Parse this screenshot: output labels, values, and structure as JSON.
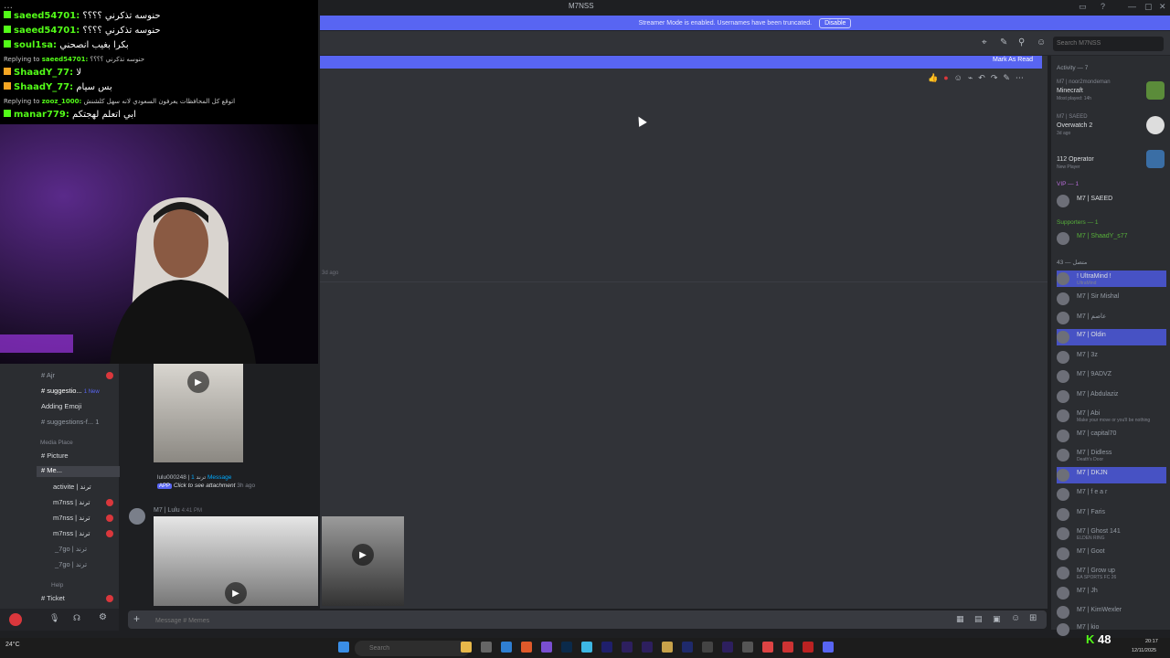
{
  "window": {
    "title": "M7NSS"
  },
  "banner": {
    "text": "Streamer Mode is enabled. Usernames have been truncated.",
    "disable_label": "Disable"
  },
  "header": {
    "search_placeholder": "Search M7NSS"
  },
  "unread": {
    "mark_as_read": "Mark As Read"
  },
  "main": {
    "ago_label": "3d ago"
  },
  "chat": [
    {
      "user": "saeed54701:",
      "text": "حنوسه تذكرني ؟؟؟؟"
    },
    {
      "user": "saeed54701:",
      "text": "حنوسه تذكرني ؟؟؟؟"
    },
    {
      "user": "soul1sa:",
      "text": "بكرا بغيب انصحني"
    },
    {
      "reply_prefix": "Replying to",
      "reply_user": "saeed54701:",
      "reply_text": "حنوسه تذكرني ؟؟؟؟"
    },
    {
      "user": "ShaadY_77:",
      "text": "لا"
    },
    {
      "user": "ShaadY_77:",
      "text": "بس سيام"
    },
    {
      "reply_prefix": "Replying to",
      "reply_user": "zooz_1000:",
      "reply_text": "اتوقع كل المحافظات يعرفون السعودي لانه سهل كلشنش"
    },
    {
      "user": "manar779:",
      "text": "ابي اتعلم لهجتكم"
    }
  ],
  "sidebar": {
    "channels": [
      {
        "name": "Ajr",
        "badge": "1"
      },
      {
        "name": "suggestio...",
        "badge": "1 New"
      },
      {
        "name": "Adding Emoji",
        "badge": ""
      },
      {
        "name": "suggestions-f...",
        "badge": "1"
      }
    ],
    "category_media": "Media Place",
    "media_channels": [
      {
        "name": "Picture"
      },
      {
        "name": "Me..."
      },
      {
        "name": "activite | ترند"
      },
      {
        "name": "m7nss | ترند"
      },
      {
        "name": "m7nss | ترند"
      },
      {
        "name": "m7nss | ترند"
      },
      {
        "name": "_7go | ترند"
      },
      {
        "name": "_7go | ترند"
      }
    ],
    "category_help": "Help",
    "help_channels": [
      {
        "name": "Ticket"
      }
    ]
  },
  "message": {
    "reply_user": "lulu000248 | ترند",
    "reply_count": "1 Message",
    "app_tag": "APP",
    "attach_text": "Click to see attachment",
    "attach_time": "3h ago",
    "author": "M7 | Lulu",
    "time": "4:41 PM"
  },
  "composer": {
    "placeholder": "Message # Memes"
  },
  "members": {
    "activity_header": "Activity — 7",
    "games": [
      {
        "user": "M7 | noor2mondeman",
        "title": "Minecraft",
        "sub": "Most played: 14h"
      },
      {
        "user": "M7 | SAEED",
        "title": "Overwatch 2",
        "sub": "3d ago"
      },
      {
        "user": "",
        "title": "112 Operator",
        "sub": "New Player"
      }
    ],
    "vip_header": "VIP — 1",
    "vip": [
      "M7 | SAEED"
    ],
    "supporters_header": "Supporters — 1",
    "supporters": [
      "M7 | ShaadY_s77"
    ],
    "online_header": "43 — متصل",
    "online": [
      {
        "name": "! UltraMind !",
        "sub": "UltraMind",
        "highlight": true
      },
      {
        "name": "M7 | Sir Mishal",
        "sub": ""
      },
      {
        "name": "M7 | عاصم",
        "sub": ""
      },
      {
        "name": "M7 | Oldin",
        "sub": "",
        "highlight": true
      },
      {
        "name": "M7 | 3z",
        "sub": ""
      },
      {
        "name": "M7 | 9ADVZ",
        "sub": ""
      },
      {
        "name": "M7 | Abdulaziz",
        "sub": ""
      },
      {
        "name": "M7 | Abi",
        "sub": "Make your move or you'll be nothing"
      },
      {
        "name": "M7 | capital70",
        "sub": ""
      },
      {
        "name": "M7 | Didless",
        "sub": "Death's Door"
      },
      {
        "name": "M7 | DKJN",
        "sub": "",
        "highlight": true
      },
      {
        "name": "M7 | f e a r",
        "sub": ""
      },
      {
        "name": "M7 | Faris",
        "sub": ""
      },
      {
        "name": "M7 | Ghost 141",
        "sub": "ELDEN RING"
      },
      {
        "name": "M7 | Goot",
        "sub": ""
      },
      {
        "name": "M7 | Grow up",
        "sub": "EA SPORTS FC 26"
      },
      {
        "name": "M7 | Jh",
        "sub": ""
      },
      {
        "name": "M7 | KimWexler",
        "sub": ""
      },
      {
        "name": "M7 | kio",
        "sub": ""
      }
    ]
  },
  "taskbar": {
    "search_placeholder": "Search",
    "weather": "24°C",
    "kick_viewers": "48",
    "date": "12/11/2025",
    "time": "20:17"
  },
  "colors": {
    "accent": "#5865f2",
    "kick_green": "#53fc18",
    "bg": "#313338"
  }
}
